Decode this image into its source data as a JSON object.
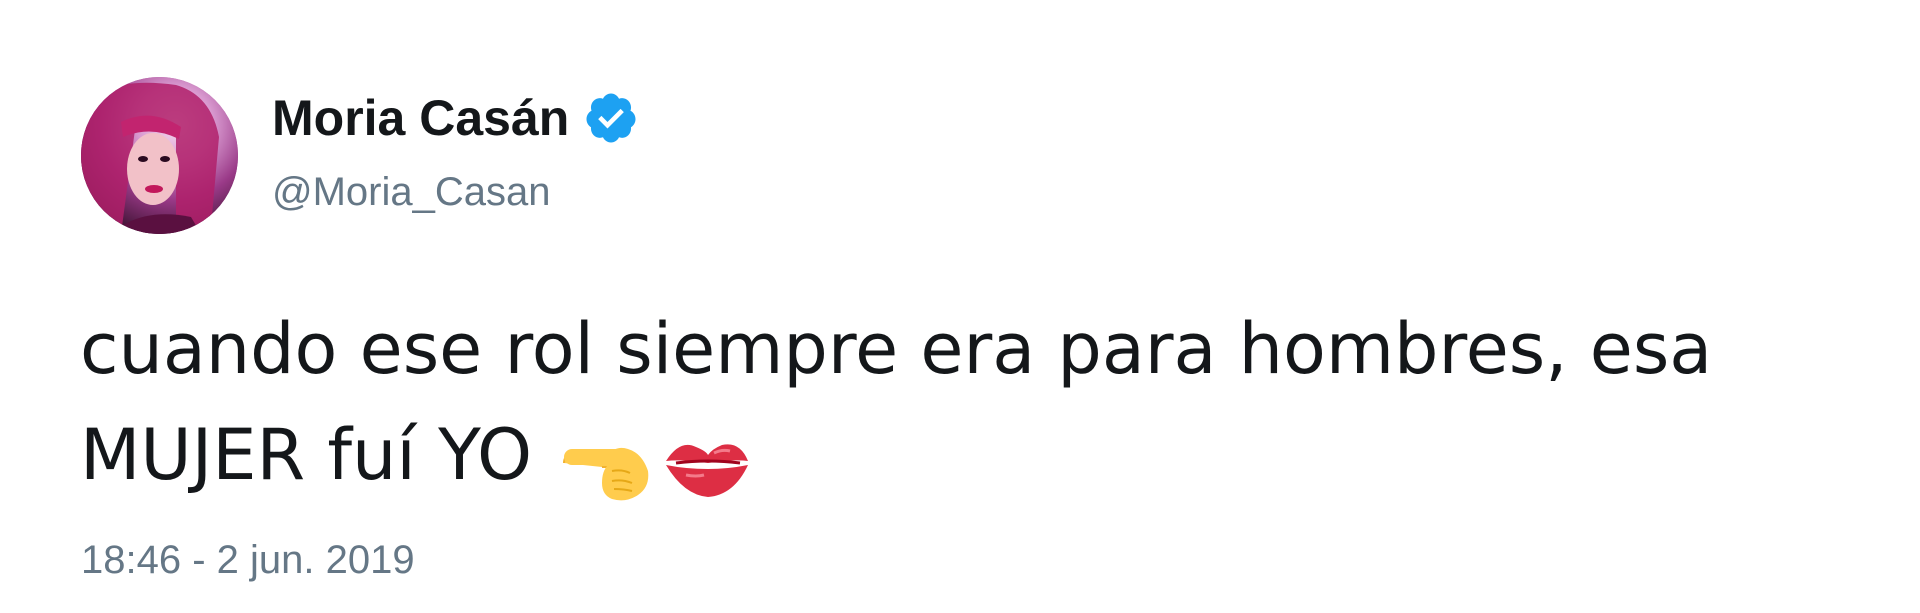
{
  "tweet": {
    "author": {
      "display_name": "Moria Casán",
      "handle": "@Moria_Casan",
      "verified": true,
      "avatar_icon": "profile-photo"
    },
    "text_lines": [
      "cuando ese rol siempre era para hombres, esa",
      "MUJER fuí YO"
    ],
    "emojis": [
      "pointing-right-emoji",
      "kiss-mark-emoji"
    ],
    "timestamp": "18:46 - 2 jun. 2019",
    "colors": {
      "text": "#14171a",
      "secondary": "#657786",
      "verified_badge": "#1da1f2"
    }
  }
}
